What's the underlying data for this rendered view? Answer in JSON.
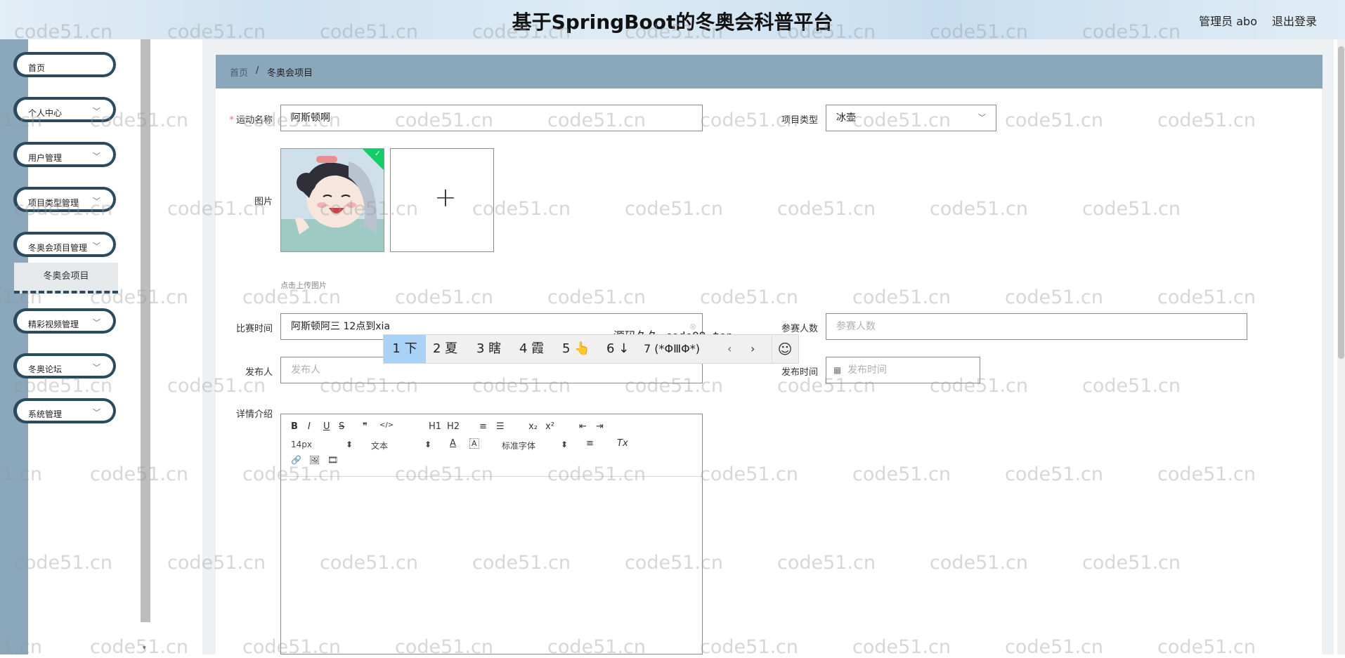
{
  "app": {
    "title": "基于SpringBoot的冬奥会科普平台",
    "user": "管理员 abo",
    "logout": "退出登录"
  },
  "sidebar": {
    "items": [
      {
        "label": "首页",
        "has_arrow": false
      },
      {
        "label": "个人中心",
        "has_arrow": true
      },
      {
        "label": "用户管理",
        "has_arrow": true
      },
      {
        "label": "项目类型管理",
        "has_arrow": true
      },
      {
        "label": "冬奥会项目管理",
        "has_arrow": true
      },
      {
        "label": "精彩视频管理",
        "has_arrow": true
      },
      {
        "label": "冬奥论坛",
        "has_arrow": true
      },
      {
        "label": "系统管理",
        "has_arrow": true
      }
    ],
    "sub_item": "冬奥会项目",
    "arrow_glyph": "﹀"
  },
  "breadcrumb": {
    "home": "首页",
    "sep": "/",
    "current": "冬奥会项目"
  },
  "form": {
    "name_label": "运动名称",
    "name_required_mark": "*",
    "name_value": "阿斯顿啊",
    "type_label": "项目类型",
    "type_value": "冰壶",
    "image_label": "图片",
    "upload_tip": "点击上传图片",
    "time_label": "比赛时间",
    "time_value": "阿斯顿阿三 12点到xia",
    "participants_label": "参赛人数",
    "participants_placeholder": "参赛人数",
    "publisher_label": "发布人",
    "publisher_placeholder": "发布人",
    "publish_time_label": "发布时间",
    "publish_time_placeholder": "发布时间",
    "detail_label": "详情介绍"
  },
  "ime": {
    "composition": "源码久久-code99.top",
    "candidates": [
      "1 下",
      "2 夏",
      "3 瞎",
      "4 霞",
      "5 👆",
      "6 ↓",
      "7 (*ΦⅢΦ*)"
    ],
    "prev": "‹",
    "next": "›",
    "emoji": "☺"
  },
  "editor": {
    "toolbar_row1": [
      "B",
      "I",
      "U",
      "S",
      "❞",
      "</>",
      "H1",
      "H2",
      "≡",
      "☰",
      "x₂",
      "x²",
      "⇤",
      "⇥"
    ],
    "size_select": "14px",
    "format_select": "文本",
    "font_color": "A",
    "bg_color": "A",
    "font_select": "标准字体",
    "align": "≡",
    "clear": "Tx",
    "toolbar_row3": [
      "🔗",
      "🖼",
      "🎞"
    ]
  },
  "watermark": "code51.cn"
}
